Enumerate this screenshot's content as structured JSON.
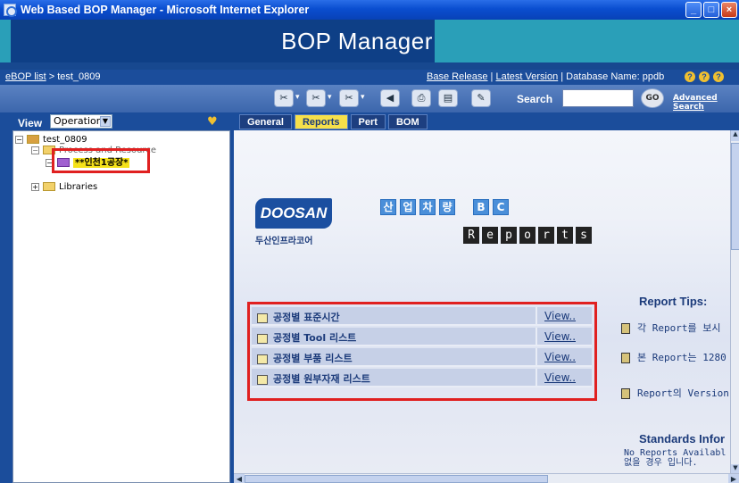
{
  "window": {
    "title": "Web Based BOP Manager - Microsoft Internet Explorer"
  },
  "banner": {
    "title": "BOP Manager"
  },
  "nav": {
    "breadcrumb_link": "eBOP list",
    "breadcrumb_rest": " > test_0809",
    "base_release": "Base Release",
    "sep": " | ",
    "latest_version": "Latest Version",
    "database": " | Database Name: ppdb"
  },
  "toolbar": {
    "search_label": "Search",
    "search_value": "",
    "go_label": "GO",
    "advanced_search": "Advanced Search"
  },
  "left": {
    "view_label": "View",
    "view_value": "Operation",
    "tree": {
      "root": "test_0809",
      "process": "Process and Resource",
      "selected": "**인천1공장*",
      "libraries": "Libraries"
    }
  },
  "tabs": [
    "General",
    "Reports",
    "Pert",
    "BOM"
  ],
  "content": {
    "company_logo": "DOOSAN",
    "company_sub": "두산인프라코어",
    "bc_title": [
      "산",
      "업",
      "차",
      "량",
      "",
      "B",
      "C"
    ],
    "reports_title": [
      "R",
      "e",
      "p",
      "o",
      "r",
      "t",
      "s"
    ],
    "reports": [
      {
        "name": "공정별 표준시간",
        "view": "View.."
      },
      {
        "name": "공정별 Tool 리스트",
        "view": "View.."
      },
      {
        "name": "공정별 부품 리스트",
        "view": "View.."
      },
      {
        "name": "공정별 원부자재 리스트",
        "view": "View.."
      }
    ],
    "tips_title": "Report Tips:",
    "tips": [
      "각 Report를 보시",
      "본 Report는 1280",
      "Report의 Version"
    ],
    "standards_title": "Standards Infor",
    "standards_text_1": "No Reports Availabl",
    "standards_text_2": "없을 경우 입니다."
  }
}
